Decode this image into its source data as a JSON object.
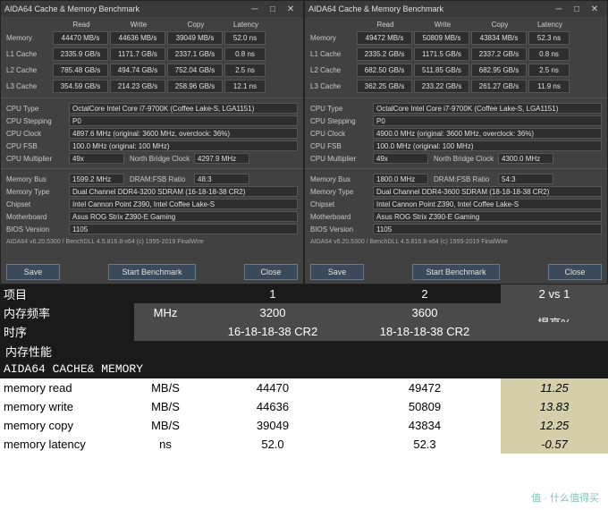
{
  "panels": [
    {
      "title": "AIDA64 Cache & Memory Benchmark",
      "headers": {
        "read": "Read",
        "write": "Write",
        "copy": "Copy",
        "latency": "Latency"
      },
      "rows": [
        {
          "label": "Memory",
          "read": "44470 MB/s",
          "write": "44636 MB/s",
          "copy": "39049 MB/s",
          "lat": "52.0 ns"
        },
        {
          "label": "L1 Cache",
          "read": "2335.9 GB/s",
          "write": "1171.7 GB/s",
          "copy": "2337.1 GB/s",
          "lat": "0.8 ns"
        },
        {
          "label": "L2 Cache",
          "read": "785.48 GB/s",
          "write": "494.74 GB/s",
          "copy": "752.04 GB/s",
          "lat": "2.5 ns"
        },
        {
          "label": "L3 Cache",
          "read": "354.59 GB/s",
          "write": "214.23 GB/s",
          "copy": "258.96 GB/s",
          "lat": "12.1 ns"
        }
      ],
      "info": {
        "cpu_type": "OctalCore Intel Core i7-9700K  (Coffee Lake-S, LGA1151)",
        "cpu_stepping": "P0",
        "cpu_clock": "4897.6 MHz  (original: 3600 MHz, overclock: 36%)",
        "cpu_fsb": "100.0 MHz  (original: 100 MHz)",
        "cpu_mult": "49x",
        "nb_clock": "4297.9 MHz",
        "mem_bus": "1599.2 MHz",
        "dram_fsb": "48:3",
        "mem_type": "Dual Channel DDR4-3200 SDRAM  (16-18-18-38 CR2)",
        "chipset": "Intel Cannon Point Z390, Intel Coffee Lake-S",
        "mobo": "Asus ROG Strix Z390-E Gaming",
        "bios": "1105"
      },
      "footer": "AIDA64 v6.20.5300 / BenchDLL 4.5.816.8-x64  (c) 1995-2019 FinalWire",
      "buttons": {
        "save": "Save",
        "start": "Start Benchmark",
        "close": "Close"
      }
    },
    {
      "title": "AIDA64 Cache & Memory Benchmark",
      "headers": {
        "read": "Read",
        "write": "Write",
        "copy": "Copy",
        "latency": "Latency"
      },
      "rows": [
        {
          "label": "Memory",
          "read": "49472 MB/s",
          "write": "50809 MB/s",
          "copy": "43834 MB/s",
          "lat": "52.3 ns"
        },
        {
          "label": "L1 Cache",
          "read": "2335.2 GB/s",
          "write": "1171.5 GB/s",
          "copy": "2337.2 GB/s",
          "lat": "0.8 ns"
        },
        {
          "label": "L2 Cache",
          "read": "682.50 GB/s",
          "write": "511.85 GB/s",
          "copy": "682.95 GB/s",
          "lat": "2.5 ns"
        },
        {
          "label": "L3 Cache",
          "read": "362.25 GB/s",
          "write": "233.22 GB/s",
          "copy": "261.27 GB/s",
          "lat": "11.9 ns"
        }
      ],
      "info": {
        "cpu_type": "OctalCore Intel Core i7-9700K  (Coffee Lake-S, LGA1151)",
        "cpu_stepping": "P0",
        "cpu_clock": "4900.0 MHz  (original: 3600 MHz, overclock: 36%)",
        "cpu_fsb": "100.0 MHz  (original: 100 MHz)",
        "cpu_mult": "49x",
        "nb_clock": "4300.0 MHz",
        "mem_bus": "1800.0 MHz",
        "dram_fsb": "54:3",
        "mem_type": "Dual Channel DDR4-3600 SDRAM  (18-18-18-38 CR2)",
        "chipset": "Intel Cannon Point Z390, Intel Coffee Lake-S",
        "mobo": "Asus ROG Strix Z390-E Gaming",
        "bios": "1105"
      },
      "footer": "AIDA64 v6.20.5300 / BenchDLL 4.5.816.8-x64  (c) 1995-2019 FinalWire",
      "buttons": {
        "save": "Save",
        "start": "Start Benchmark",
        "close": "Close"
      }
    }
  ],
  "labels": {
    "cpu_type": "CPU Type",
    "cpu_stepping": "CPU Stepping",
    "cpu_clock": "CPU Clock",
    "cpu_fsb": "CPU FSB",
    "cpu_mult": "CPU Multiplier",
    "nb_clock": "North Bridge Clock",
    "mem_bus": "Memory Bus",
    "dram_fsb": "DRAM:FSB Ratio",
    "mem_type": "Memory Type",
    "chipset": "Chipset",
    "mobo": "Motherboard",
    "bios": "BIOS Version"
  },
  "comparison": {
    "header": {
      "c1": "项目",
      "c3": "1",
      "c4": "2",
      "c5": "2 vs 1"
    },
    "freq": {
      "label": "内存频率",
      "unit": "MHz",
      "v1": "3200",
      "v2": "3600",
      "pct": "提高%"
    },
    "timing": {
      "label": "时序",
      "unit": "",
      "v1": "16-18-18-38 CR2",
      "v2": "18-18-18-38 CR2"
    },
    "perf": "内存性能",
    "aida": "AIDA64 CACHE& MEMORY",
    "rows": [
      {
        "label": "memory read",
        "unit": "MB/S",
        "v1": "44470",
        "v2": "49472",
        "pct": "11.25"
      },
      {
        "label": "memory write",
        "unit": "MB/S",
        "v1": "44636",
        "v2": "50809",
        "pct": "13.83"
      },
      {
        "label": "memory copy",
        "unit": "MB/S",
        "v1": "39049",
        "v2": "43834",
        "pct": "12.25"
      },
      {
        "label": "memory latency",
        "unit": "ns",
        "v1": "52.0",
        "v2": "52.3",
        "pct": "-0.57"
      }
    ]
  },
  "watermark": "值 · 什么值得买"
}
